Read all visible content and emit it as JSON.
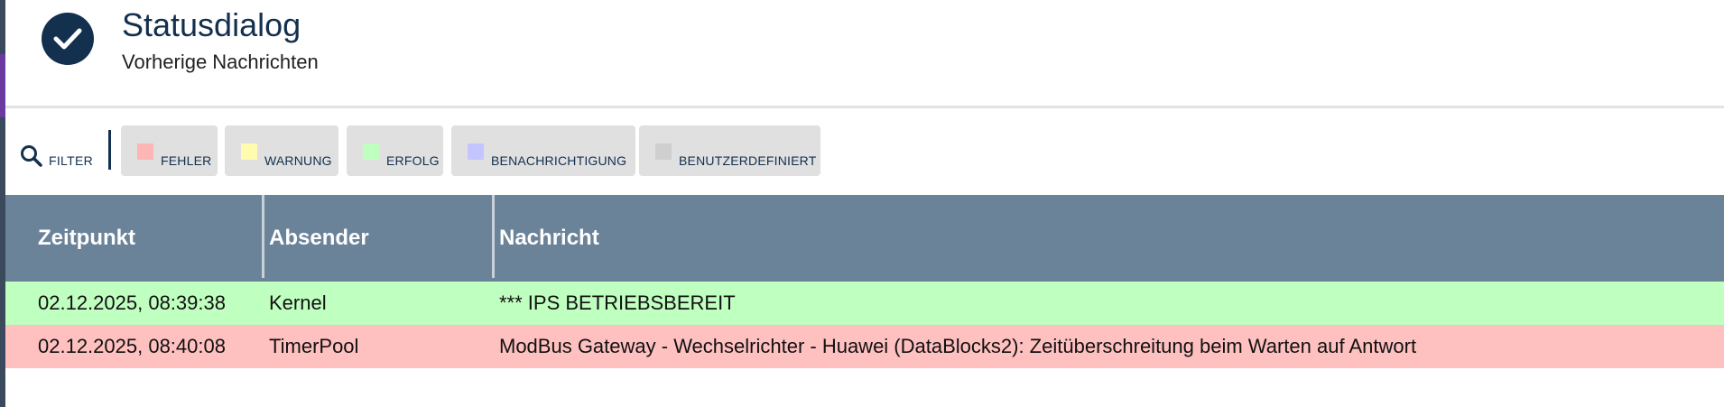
{
  "header": {
    "title": "Statusdialog",
    "subtitle": "Vorherige Nachrichten",
    "icon": "check-circle-icon",
    "icon_color": "#13304f"
  },
  "filter": {
    "label": "FILTER",
    "icon": "search-icon",
    "chips": [
      {
        "label": "FEHLER",
        "color": "#fcb6b6"
      },
      {
        "label": "WARNUNG",
        "color": "#fffcb0"
      },
      {
        "label": "ERFOLG",
        "color": "#bfffbf"
      },
      {
        "label": "BENACHRICHTIGUNG",
        "color": "#c4c4ff"
      },
      {
        "label": "BENUTZERDEFINIERT",
        "color": "#cfcfcf"
      }
    ]
  },
  "table": {
    "columns": [
      "Zeitpunkt",
      "Absender",
      "Nachricht"
    ],
    "header_color": "#6b8399",
    "rows": [
      {
        "time": "02.12.2025, 08:39:38",
        "sender": "Kernel",
        "message": "*** IPS BETRIEBSBEREIT",
        "color": "#bfffbf"
      },
      {
        "time": "02.12.2025, 08:40:08",
        "sender": "TimerPool",
        "message": "ModBus Gateway - Wechselrichter - Huawei (DataBlocks2): Zeitüberschreitung beim Warten auf Antwort",
        "color": "#ffc0c0"
      }
    ]
  }
}
